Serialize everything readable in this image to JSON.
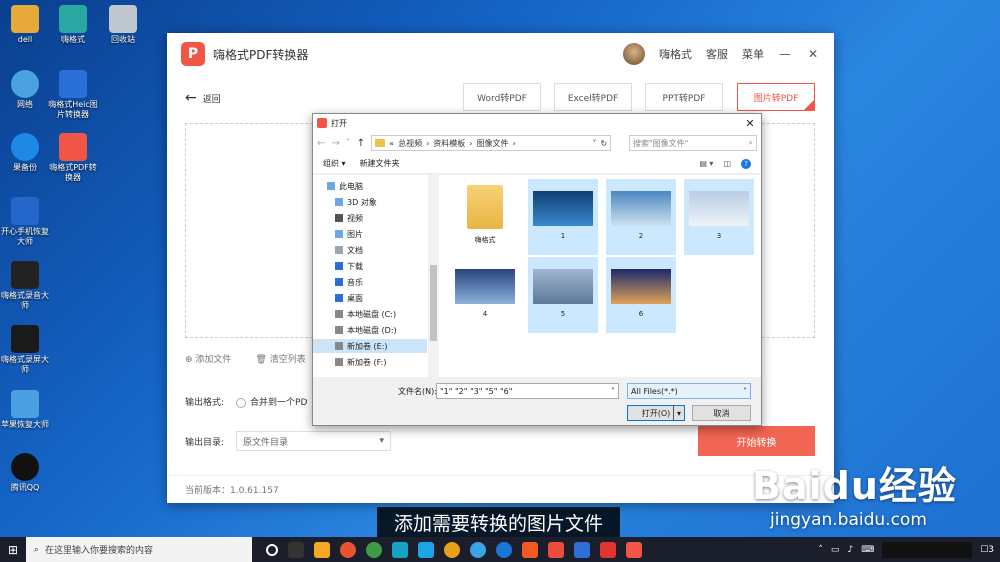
{
  "desktop": {
    "icons": [
      {
        "label": "dell",
        "color": "#e6a93a"
      },
      {
        "label": "嗨格式",
        "color": "#2aa7a2"
      },
      {
        "label": "回收站",
        "color": "#bfc7d0"
      },
      {
        "label": "网络",
        "color": "#4aa3df"
      },
      {
        "label": "嗨格式Heic图片转换器",
        "color": "#2a6fd6"
      },
      {
        "label": "果备份",
        "color": "#1e88e5"
      },
      {
        "label": "嗨格式PDF转换器",
        "color": "#f05545"
      },
      {
        "label": "开心手机恢复大师",
        "color": "#2466c9"
      },
      {
        "label": "嗨格式录音大师",
        "color": "#222222"
      },
      {
        "label": "嗨格式录屏大师",
        "color": "#1a1a1a"
      },
      {
        "label": "苹果恢复大师",
        "color": "#4aa0e0"
      },
      {
        "label": "腾讯QQ",
        "color": "#111111"
      }
    ]
  },
  "app": {
    "title": "嗨格式PDF转换器",
    "user_name": "嗨格式",
    "service": "客服",
    "menu": "菜单",
    "minimize": "—",
    "close": "✕",
    "back": "返回",
    "tabs": [
      {
        "label": "Word转PDF",
        "active": false
      },
      {
        "label": "Excel转PDF",
        "active": false
      },
      {
        "label": "PPT转PDF",
        "active": false
      },
      {
        "label": "图片转PDF",
        "active": true
      }
    ],
    "add_file": "添加文件",
    "clear_list": "清空列表",
    "output_format_label": "输出格式:",
    "merge_option": "合并到一个PD",
    "output_dir_label": "输出目录:",
    "output_dir_value": "原文件目录",
    "start_button": "开始转换",
    "version": "当前版本：1.0.61.157",
    "accent": "#f05545"
  },
  "dialog": {
    "title": "打开",
    "close": "✕",
    "breadcrumb": [
      "«",
      "总视频",
      "›",
      "资料模板",
      "›",
      "图像文件",
      "›"
    ],
    "search_placeholder": "搜索\"图像文件\"",
    "organize": "组织 ▾",
    "new_folder": "新建文件夹",
    "help": "?",
    "tree": [
      {
        "label": "此电脑",
        "selected": false
      },
      {
        "label": "3D 对象",
        "selected": false
      },
      {
        "label": "视频",
        "selected": false
      },
      {
        "label": "图片",
        "selected": false
      },
      {
        "label": "文档",
        "selected": false
      },
      {
        "label": "下载",
        "selected": false
      },
      {
        "label": "音乐",
        "selected": false
      },
      {
        "label": "桌面",
        "selected": false
      },
      {
        "label": "本地磁盘 (C:)",
        "selected": false
      },
      {
        "label": "本地磁盘 (D:)",
        "selected": false
      },
      {
        "label": "新加卷 (E:)",
        "selected": true
      },
      {
        "label": "新加卷 (F:)",
        "selected": false
      }
    ],
    "files": [
      {
        "name": "嗨格式",
        "type": "folder",
        "selected": false
      },
      {
        "name": "1",
        "type": "image",
        "selected": true,
        "color": "#1d5f9e"
      },
      {
        "name": "2",
        "type": "image",
        "selected": true,
        "color": "#6da0c8"
      },
      {
        "name": "3",
        "type": "image",
        "selected": true,
        "color": "#9db8d6"
      },
      {
        "name": "4",
        "type": "image",
        "selected": false,
        "color": "#3b5e9a"
      },
      {
        "name": "5",
        "type": "image",
        "selected": true,
        "color": "#7f9cbf"
      },
      {
        "name": "6",
        "type": "image",
        "selected": true,
        "color": "#2a3f8f"
      }
    ],
    "filename_label": "文件名(N):",
    "filename_value": "\"1\" \"2\" \"3\" \"5\" \"6\"",
    "filetype_value": "All Files(*.*)",
    "open_button": "打开(O)",
    "cancel_button": "取消"
  },
  "subtitle": "添加需要转换的图片文件",
  "watermark": {
    "main": "Baidu经验",
    "sub": "jingyan.baidu.com"
  },
  "taskbar": {
    "search_placeholder": "在这里输入你要搜索的内容",
    "apps": [
      "#1b1b1b",
      "#1b1b1b",
      "#f7a823",
      "#e8532f",
      "#3f9b44",
      "#16a3c8",
      "#1ca4e4",
      "#e8a01a",
      "#3aa3e8",
      "#1978d6",
      "#f25a22",
      "#ec4c3a",
      "#2f6fd8",
      "#e0342f",
      "#f05545"
    ],
    "notification_count": "3"
  }
}
